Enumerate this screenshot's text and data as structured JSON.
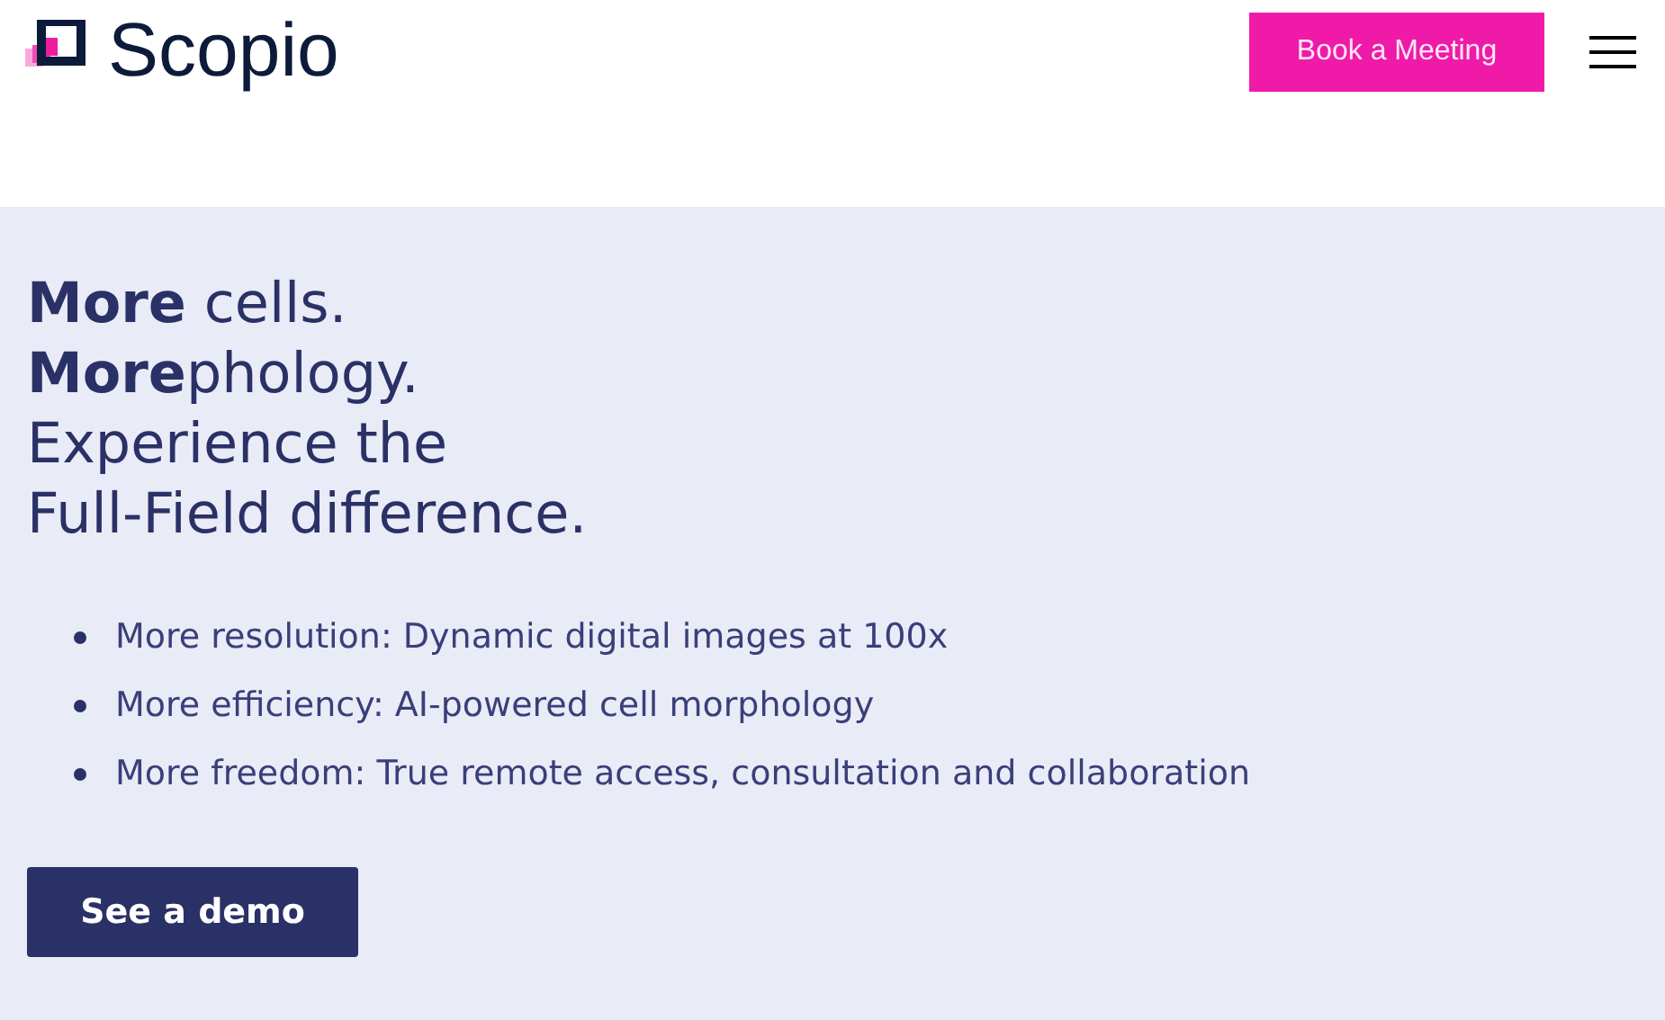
{
  "header": {
    "logo": "Scopio",
    "cta": "Book a Meeting"
  },
  "hero": {
    "heading": [
      "**More** cells.",
      "**More**phology.",
      "Experience the",
      "Full-Field difference."
    ],
    "bullets": [
      "More resolution: Dynamic digital images at 100x",
      "More efficiency: AI-powered cell morphology",
      "More freedom: True remote access, consultation and collaboration"
    ],
    "button": "See a demo"
  }
}
